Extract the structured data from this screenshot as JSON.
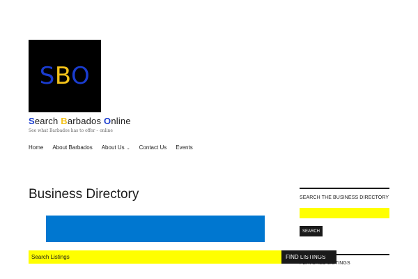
{
  "logo": {
    "letters": [
      {
        "char": "S",
        "color": "#1a3ccf"
      },
      {
        "char": "B",
        "color": "#f3c21a"
      },
      {
        "char": "O",
        "color": "#1a3ccf"
      }
    ]
  },
  "site": {
    "title_parts": [
      {
        "cap": "S",
        "rest": "earch ",
        "cap_color": "#1a3ccf"
      },
      {
        "cap": "B",
        "rest": "arbados ",
        "cap_color": "#f3c21a"
      },
      {
        "cap": "O",
        "rest": "nline",
        "cap_color": "#1a3ccf"
      }
    ],
    "tagline": "See what Barbados has to offer – online"
  },
  "nav": {
    "items": [
      {
        "label": "Home"
      },
      {
        "label": "About Barbados"
      },
      {
        "label": "About Us",
        "has_dropdown": true
      },
      {
        "label": "Contact Us"
      },
      {
        "label": "Events"
      }
    ]
  },
  "main": {
    "page_title": "Business Directory",
    "search_placeholder": "Search Listings",
    "find_button": "FIND LISTINGS"
  },
  "sidebar": {
    "search_widget_title": "SEARCH THE BUSINESS DIRECTORY",
    "search_button": "SEARCH",
    "featured_title": "FEATURED LISTINGS"
  },
  "colors": {
    "yellow": "#ffff00",
    "blue_banner": "#0077d0",
    "dark": "#1a1a1a"
  }
}
